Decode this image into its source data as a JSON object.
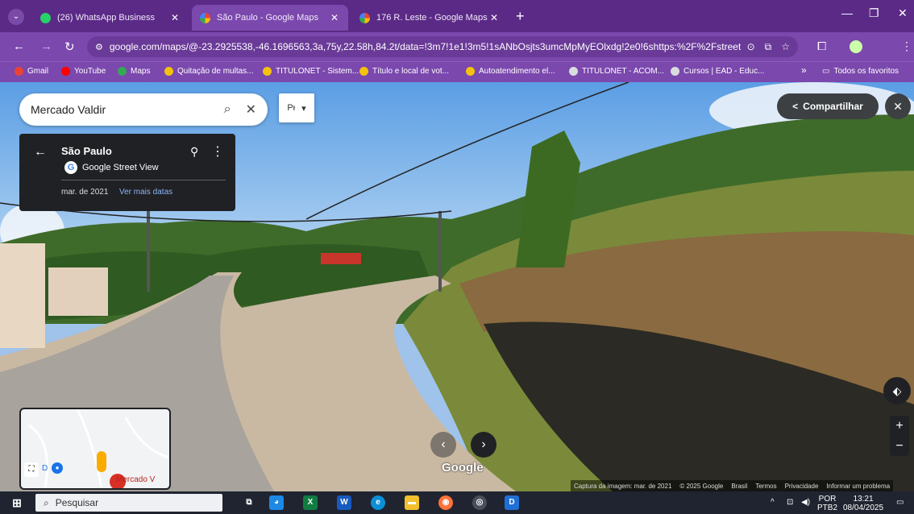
{
  "browser": {
    "tabs": [
      {
        "label": "(26) WhatsApp Business",
        "badge": "26",
        "active": false
      },
      {
        "label": "São Paulo - Google Maps",
        "active": true
      },
      {
        "label": "176 R. Leste - Google Maps",
        "active": false
      }
    ],
    "address": {
      "domain": "google.com",
      "path": "/maps/@-23.2925538,-46.1696563,3a,75y,22.58h,84.2t/data=!3m7!1e1!3m5!1sANbOsjts3umcMpMyEOlxdg!2e0!6shttps:%2F%2Fstreetviewpixel..."
    },
    "bookmarks": [
      {
        "label": "Gmail",
        "color": "#ea4335"
      },
      {
        "label": "YouTube",
        "color": "#ff0000"
      },
      {
        "label": "Maps",
        "color": "#34a853"
      },
      {
        "label": "Quitação de multas...",
        "color": "#f4c20d"
      },
      {
        "label": "TITULONET - Sistem...",
        "color": "#f4c20d"
      },
      {
        "label": "Título e local de vot...",
        "color": "#f4c20d"
      },
      {
        "label": "Autoatendimento el...",
        "color": "#f4c20d"
      },
      {
        "label": "TITULONET - ACOM...",
        "color": "#9aa0a6"
      },
      {
        "label": "Cursos | EAD - Educ...",
        "color": "#9aa0a6"
      }
    ],
    "bookmarks_more": "»",
    "all_favorites": "Todos os favoritos"
  },
  "maps": {
    "search_value": "Mercado Valdir",
    "place_title": "São Paulo",
    "source": "Google Street View",
    "capture_date": "mar. de 2021",
    "more_dates": "Ver mais datas",
    "share_label": "Compartilhar",
    "minimap_label": "Mercado V",
    "minimap_badge": "D",
    "google_logo": "Google",
    "attribution": {
      "capture": "Captura da imagem: mar. de 2021",
      "copyright": "© 2025 Google",
      "country": "Brasil",
      "terms": "Termos",
      "privacy": "Privacidade",
      "report": "Informar um problema"
    }
  },
  "taskbar": {
    "search_placeholder": "Pesquisar",
    "language": "POR",
    "keyboard": "PTB2",
    "time": "13:21",
    "date": "08/04/2025"
  }
}
